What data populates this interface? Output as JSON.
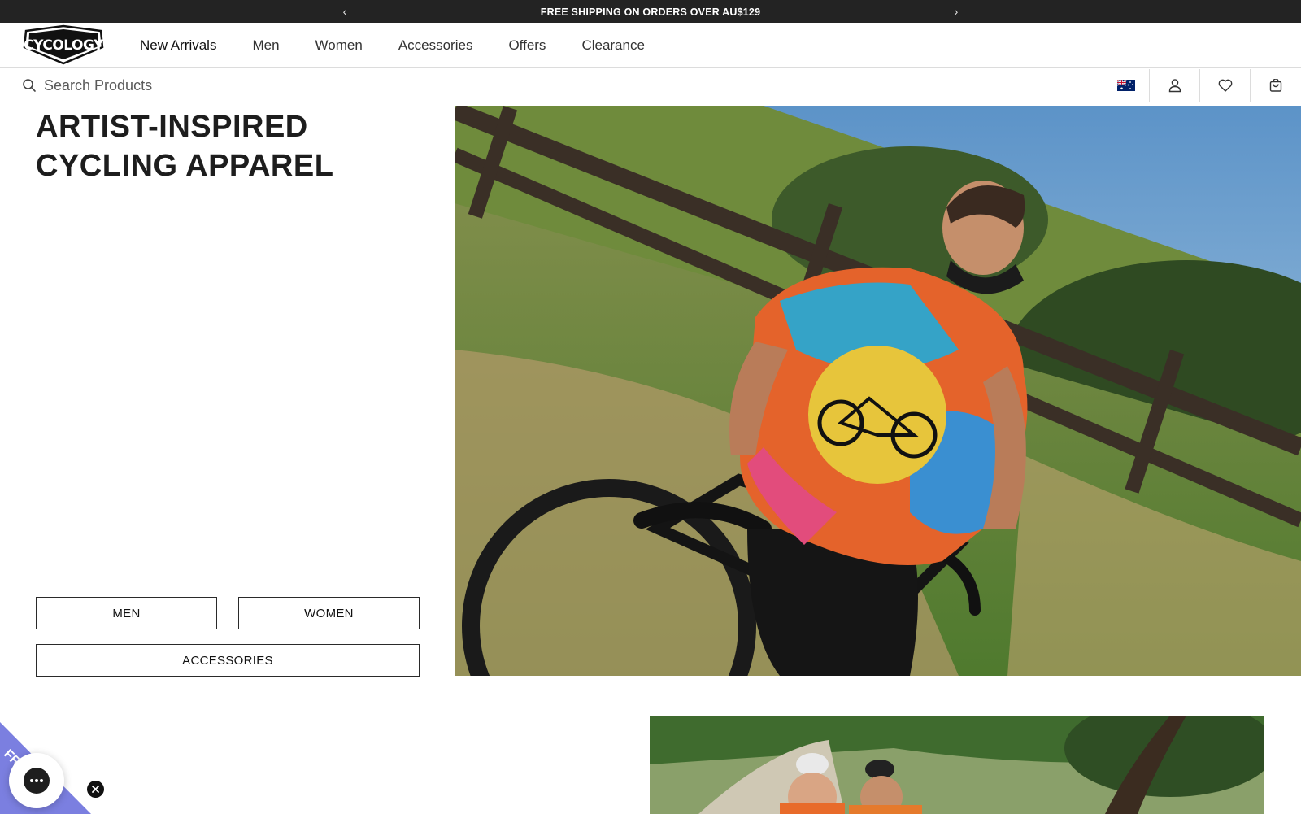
{
  "announcement": {
    "message": "FREE SHIPPING ON ORDERS OVER AU$129",
    "prev_icon": "chevron-left-icon",
    "next_icon": "chevron-right-icon"
  },
  "header": {
    "logo_text": "CYCOLOGY",
    "nav": [
      "New Arrivals",
      "Men",
      "Women",
      "Accessories",
      "Offers",
      "Clearance"
    ]
  },
  "search": {
    "placeholder": "Search Products",
    "icon": "search-icon"
  },
  "utilities": {
    "icons": [
      "australia-flag-icon",
      "account-icon",
      "wishlist-heart-icon",
      "cart-bag-icon"
    ]
  },
  "hero": {
    "title": "ARTIST-INSPIRED CYCLING APPAREL",
    "buttons": {
      "men": "MEN",
      "women": "WOMEN",
      "accessories": "ACCESSORIES"
    }
  },
  "promo_tab": {
    "label": "FR... R",
    "color": "#7b7fe0"
  },
  "colors": {
    "announcement_bg": "#232323",
    "border": "#dcdcdc",
    "text": "#1a1a1a"
  }
}
